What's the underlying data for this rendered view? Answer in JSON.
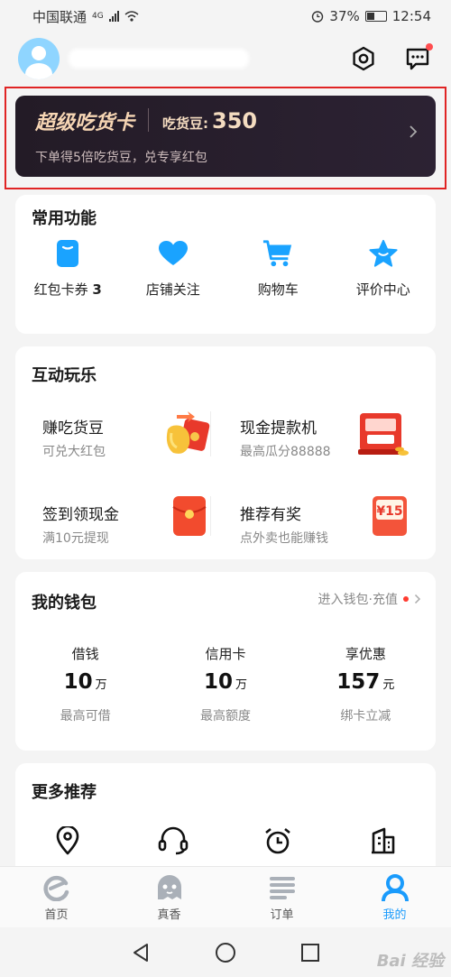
{
  "status_bar": {
    "carrier": "中国联通",
    "network": "4G",
    "battery": "37%",
    "time": "12:54"
  },
  "super_card": {
    "title": "超级吃货卡",
    "beans_label": "吃货豆:",
    "beans_value": "350",
    "subtitle": "下单得5倍吃货豆，兑专享红包"
  },
  "common": {
    "title": "常用功能",
    "items": [
      {
        "label": "红包卡券",
        "count": "3",
        "icon": "coupon-icon"
      },
      {
        "label": "店铺关注",
        "icon": "heart-icon"
      },
      {
        "label": "购物车",
        "icon": "cart-icon"
      },
      {
        "label": "评价中心",
        "icon": "star-icon"
      }
    ]
  },
  "interact": {
    "title": "互动玩乐",
    "items": [
      {
        "name": "赚吃货豆",
        "desc": "可兑大红包"
      },
      {
        "name": "现金提款机",
        "desc": "最高瓜分88888"
      },
      {
        "name": "签到领现金",
        "desc": "满10元提现"
      },
      {
        "name": "推荐有奖",
        "desc": "点外卖也能赚钱",
        "badge": "¥15"
      }
    ]
  },
  "wallet": {
    "title": "我的钱包",
    "link": "进入钱包·充值",
    "cols": [
      {
        "label": "借钱",
        "value": "10",
        "unit": "万",
        "hint": "最高可借"
      },
      {
        "label": "信用卡",
        "value": "10",
        "unit": "万",
        "hint": "最高额度"
      },
      {
        "label": "享优惠",
        "value": "157",
        "unit": "元",
        "hint": "绑卡立减"
      }
    ]
  },
  "more": {
    "title": "更多推荐",
    "icons": [
      "location-icon",
      "headset-icon",
      "alarm-clock-icon",
      "building-icon"
    ]
  },
  "tabs": [
    {
      "label": "首页",
      "icon": "home-e-icon"
    },
    {
      "label": "真香",
      "icon": "ghost-icon"
    },
    {
      "label": "订单",
      "icon": "list-icon"
    },
    {
      "label": "我的",
      "icon": "person-icon",
      "active": true
    }
  ],
  "watermark": "Bai 经验",
  "colors": {
    "accent": "#1a9bfc",
    "card_dark": "#231b26",
    "highlight_border": "#e02424",
    "gold": "#f7d6b4"
  }
}
